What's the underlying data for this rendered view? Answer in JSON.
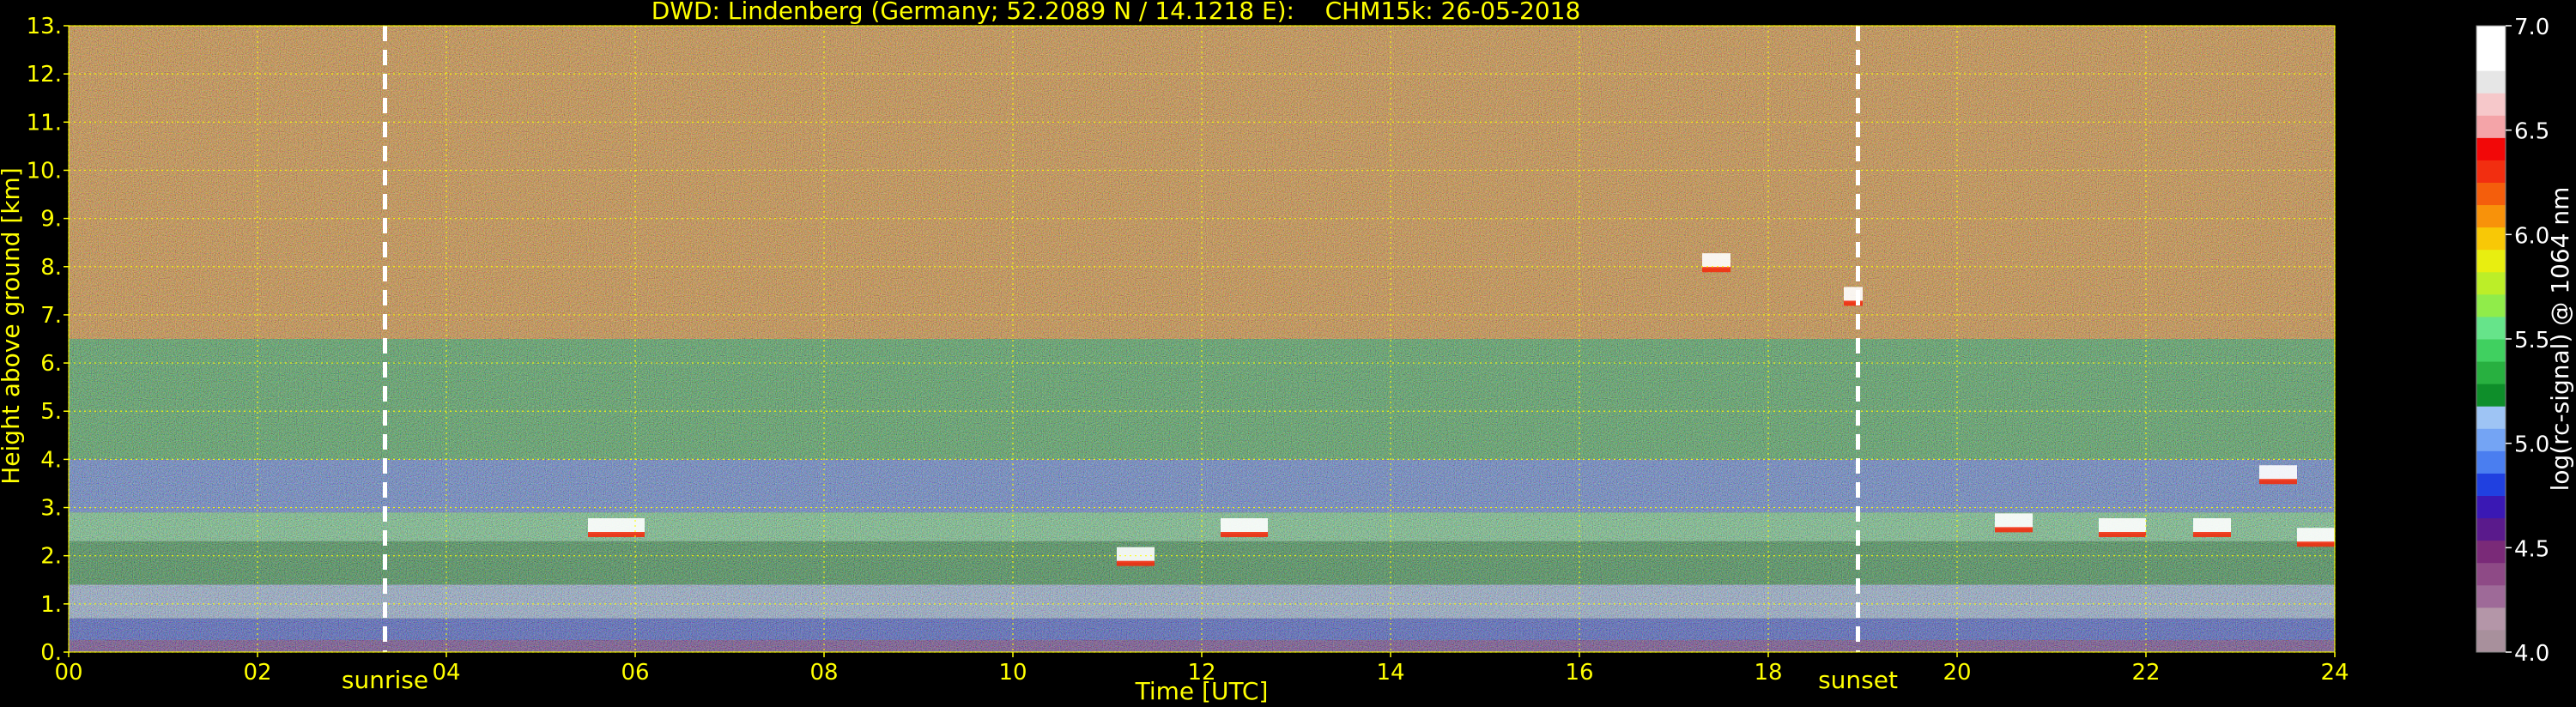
{
  "chart_data": {
    "type": "heatmap",
    "title": "DWD: Lindenberg (Germany; 52.2089 N / 14.1218 E):    CHM15k: 26-05-2018",
    "xlabel": "Time [UTC]",
    "ylabel": "Height above ground [km]",
    "xlim": [
      0,
      24
    ],
    "ylim": [
      0,
      13
    ],
    "x_tick_labels": [
      "00",
      "02",
      "04",
      "06",
      "08",
      "10",
      "12",
      "14",
      "16",
      "18",
      "20",
      "22",
      "24"
    ],
    "y_tick_labels": [
      "0.",
      "1.",
      "2.",
      "3.",
      "4.",
      "5.",
      "6.",
      "7.",
      "8.",
      "9.",
      "10.",
      "11.",
      "12.",
      "13."
    ],
    "grid": true,
    "annotations": [
      {
        "label": "sunrise",
        "x": 3.35
      },
      {
        "label": "sunset",
        "x": 18.95
      }
    ],
    "layers": [
      {
        "from_km": 0.0,
        "to_km": 0.25,
        "value": 4.6
      },
      {
        "from_km": 0.25,
        "to_km": 0.7,
        "value": 4.8
      },
      {
        "from_km": 0.7,
        "to_km": 1.4,
        "value": 5.1
      },
      {
        "from_km": 1.4,
        "to_km": 2.3,
        "value": 5.2
      },
      {
        "from_km": 2.3,
        "to_km": 2.9,
        "value": 5.5
      },
      {
        "from_km": 2.9,
        "to_km": 4.0,
        "value": 4.9
      },
      {
        "from_km": 4.0,
        "to_km": 6.5,
        "value": 5.3
      },
      {
        "from_km": 6.5,
        "to_km": 13.0,
        "value": 6.1
      }
    ],
    "clouds": [
      {
        "x_start": 5.5,
        "x_end": 6.1,
        "height_km": 2.6
      },
      {
        "x_start": 11.1,
        "x_end": 11.5,
        "height_km": 2.0
      },
      {
        "x_start": 12.2,
        "x_end": 12.7,
        "height_km": 2.6
      },
      {
        "x_start": 17.3,
        "x_end": 17.6,
        "height_km": 8.1
      },
      {
        "x_start": 18.8,
        "x_end": 19.0,
        "height_km": 7.4
      },
      {
        "x_start": 20.4,
        "x_end": 20.8,
        "height_km": 2.7
      },
      {
        "x_start": 21.5,
        "x_end": 22.0,
        "height_km": 2.6
      },
      {
        "x_start": 22.5,
        "x_end": 22.9,
        "height_km": 2.6
      },
      {
        "x_start": 23.2,
        "x_end": 23.6,
        "height_km": 3.7
      },
      {
        "x_start": 23.6,
        "x_end": 24.0,
        "height_km": 2.4
      }
    ],
    "colorbar": {
      "label": "log(rc-signal) @ 1064 nm",
      "range": [
        4.0,
        7.0
      ],
      "tick_labels": [
        "4.0",
        "4.5",
        "5.0",
        "5.5",
        "6.0",
        "6.5",
        "7.0"
      ],
      "colors": [
        "#a8909c",
        "#b496a8",
        "#9e6a98",
        "#8e4a86",
        "#7a2a78",
        "#5a1a8c",
        "#3a18b4",
        "#2040e0",
        "#4a7ef0",
        "#74a4f4",
        "#9ec4f4",
        "#0e8e2a",
        "#28b040",
        "#40d060",
        "#66e48a",
        "#90ec4a",
        "#bcee28",
        "#e8ee10",
        "#f8c806",
        "#f8920a",
        "#f45e0c",
        "#f22e10",
        "#f20808",
        "#f4a4a8",
        "#f6c8ca",
        "#e6e6e6",
        "#ffffff",
        "#ffffff"
      ]
    },
    "colors": {
      "text": "#ffff00",
      "grid": "#ffff00",
      "background": "#000000",
      "markers": "#ffffff"
    }
  }
}
